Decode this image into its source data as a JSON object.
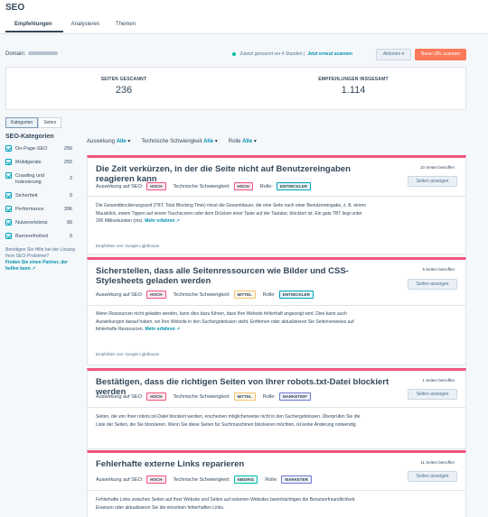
{
  "app": {
    "title": "SEO"
  },
  "tabs": [
    {
      "label": "Empfehlungen"
    },
    {
      "label": "Analysieren"
    },
    {
      "label": "Themen"
    }
  ],
  "toolbar": {
    "domain_label": "Domain:",
    "scan_status": "Zuletzt gescannt vor 4 Stunden |",
    "rescan_link": "Jetzt erneut scannen",
    "actions_label": "Aktionen ▾",
    "new_url_label": "Neue URL scannen"
  },
  "stats": {
    "pages_label": "SEITEN GESCANNT",
    "pages_value": "236",
    "recs_label": "EMPFEHLUNGEN INSGESAMT",
    "recs_value": "1.114"
  },
  "view_toggle": {
    "categories": "Kategorien",
    "pages": "Seiten"
  },
  "filters": {
    "impact_label": "Auswirkung",
    "impact_value": "Alle",
    "difficulty_label": "Technische Schwierigkeit",
    "difficulty_value": "Alle",
    "role_label": "Rolle",
    "role_value": "Alle"
  },
  "sidebar": {
    "title": "SEO-Kategorien",
    "items": [
      {
        "label": "On-Page-SEO",
        "count": "256"
      },
      {
        "label": "Mobilgeräte",
        "count": "255"
      },
      {
        "label": "Crawling und Indexierung",
        "count": "2"
      },
      {
        "label": "Sicherheit",
        "count": "0"
      },
      {
        "label": "Performance",
        "count": "396"
      },
      {
        "label": "Nutzererlebnis",
        "count": "99"
      },
      {
        "label": "Barrierefreiheit",
        "count": "0"
      }
    ],
    "help_text": "Benötigen Sie Hilfe bei der Lösung Ihrer SEO-Probleme?",
    "help_link": "Finden Sie einen Partner, der helfen kann ↗"
  },
  "card_common": {
    "impact_label": "Auswirkung auf SEO:",
    "difficulty_label": "Technische Schwierigkeit:",
    "role_label": "Rolle:",
    "view_button": "Seiten anzeigen",
    "more_link": "Mehr erfahren ↗",
    "source": "Empfohlen von: Google Lighthouse"
  },
  "cards": [
    {
      "title": "Die Zeit verkürzen, in der die Seite nicht auf Benutzereingaben reagieren kann",
      "affected": "10 Seiten betroffen",
      "impact": "HOCH",
      "difficulty": "HOCH",
      "role": "ENTWICKLER",
      "description": "Die Gesamtblockierungszeit (TBT, Total Blocking Time) misst die Gesamtdauer, die eine Seite nach einer Benutzereingabe, z. B. einem Mausklick, einem Tippen auf einem Touchscreen oder dem Drücken einer Taste auf der Tastatur, blockiert ist. Ein gute TBT liegt unter 200 Millisekunden (ms)."
    },
    {
      "title": "Sicherstellen, dass alle Seitenressourcen wie Bilder und CSS-Stylesheets geladen werden",
      "affected": "5 Seiten betroffen",
      "impact": "HOCH",
      "difficulty": "MITTEL",
      "role": "ENTWICKLER",
      "description": "Wenn Ressourcen nicht geladen werden, kann dies dazu führen, dass Ihre Website fehlerhaft angezeigt wird. Dies kann auch Auswirkungen darauf haben, wo Ihre Website in den Suchergebnissen steht. Entfernen oder aktualisieren Sie Seitenverweise auf fehlerhafte Ressourcen."
    },
    {
      "title": "Bestätigen, dass die richtigen Seiten von Ihrer robots.txt-Datei blockiert werden",
      "affected": "1 Seiten betroffen",
      "impact": "HOCH",
      "difficulty": "MITTEL",
      "role": "MARKETER*",
      "description": "Seiten, die von Ihrer robots.txt-Datei blockiert werden, erscheinen möglicherweise nicht in den Suchergebnissen. Überprüfen Sie die Liste der Seiten, die Sie blockieren. Wenn Sie diese Seiten für Suchmaschinen blockieren möchten, ist keine Änderung notwendig."
    },
    {
      "title": "Fehlerhafte externe Links reparieren",
      "affected": "11 Seiten betroffen",
      "impact": "HOCH",
      "difficulty": "NIEDRIG",
      "role": "MARKETER",
      "description": "Fehlerhafte Links zwischen Seiten auf Ihrer Website und Seiten auf externen Websites beeinträchtigen die Benutzerfreundlichkeit. Ersetzen oder aktualisieren Sie die einzelnen fehlerhaften Links."
    }
  ]
}
